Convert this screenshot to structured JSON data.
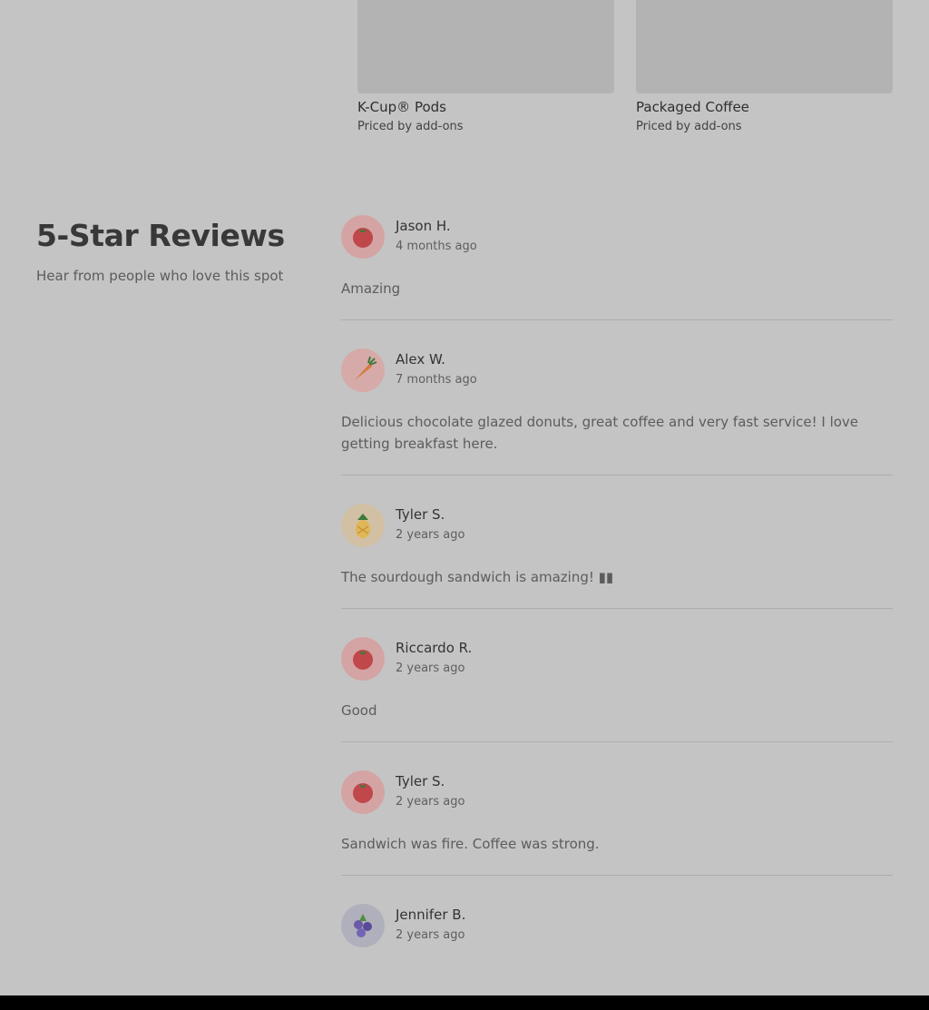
{
  "products": [
    {
      "name": "K-Cup® Pods",
      "price": "Priced by add-ons"
    },
    {
      "name": "Packaged Coffee",
      "price": "Priced by add-ons"
    }
  ],
  "reviews_section": {
    "title": "5-Star Reviews",
    "subtitle": "Hear from people who love this spot"
  },
  "reviews": [
    {
      "name": "Jason H.",
      "date": "4 months ago",
      "text": "Amazing",
      "avatar": "tomato-icon"
    },
    {
      "name": "Alex W.",
      "date": "7 months ago",
      "text": "Delicious chocolate glazed donuts, great coffee and very fast service! I love getting breakfast here.",
      "avatar": "carrot-icon"
    },
    {
      "name": "Tyler S.",
      "date": "2 years ago",
      "text": "The sourdough sandwich is amazing! ▮▮",
      "avatar": "pineapple-icon"
    },
    {
      "name": "Riccardo R.",
      "date": "2 years ago",
      "text": "Good",
      "avatar": "tomato-icon"
    },
    {
      "name": "Tyler S.",
      "date": "2 years ago",
      "text": "Sandwich was fire. Coffee was strong.",
      "avatar": "tomato-icon"
    },
    {
      "name": "Jennifer B.",
      "date": "2 years ago",
      "text": "",
      "avatar": "blueberry-icon"
    }
  ],
  "colors": {
    "background": "#c4c4c4",
    "placeholder": "#b3b3b3",
    "divider": "#adadad",
    "avatar_tomato_bg": "#d4a4a4",
    "avatar_carrot_bg": "#d6aaa8",
    "avatar_pineapple_bg": "#d2c0a4",
    "avatar_blueberry_bg": "#b0b0bc"
  }
}
